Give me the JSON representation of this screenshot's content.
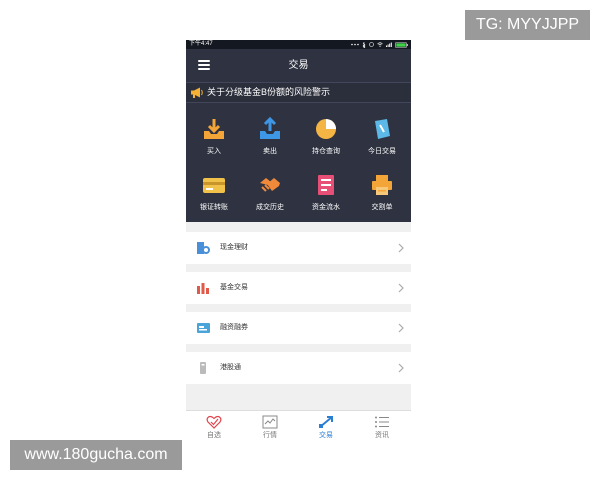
{
  "watermarks": {
    "top_right": "TG: MYYJJPP",
    "bottom_left": "www.180gucha.com"
  },
  "status_bar": {
    "time": "下午4:47",
    "icons": [
      "dots-icon",
      "bluetooth-icon",
      "alarm-icon",
      "wifi-icon",
      "signal-icon",
      "battery-icon"
    ]
  },
  "header": {
    "title": "交易",
    "menu_icon": "menu-icon"
  },
  "notice": {
    "text": "关于分级基金B份额的风险警示",
    "icon": "megaphone-icon"
  },
  "grid": [
    {
      "label": "买入",
      "icon": "buy-download-icon",
      "color": "#f3a537"
    },
    {
      "label": "卖出",
      "icon": "sell-upload-icon",
      "color": "#3d97e6"
    },
    {
      "label": "持仓查询",
      "icon": "pie-chart-icon",
      "color": "#f5b545"
    },
    {
      "label": "今日交易",
      "icon": "note-pencil-icon",
      "color": "#5bb8e8"
    },
    {
      "label": "银证转账",
      "icon": "card-icon",
      "color": "#f0c24a"
    },
    {
      "label": "成交历史",
      "icon": "handshake-icon",
      "color": "#f08a3a"
    },
    {
      "label": "资金流水",
      "icon": "ledger-icon",
      "color": "#e84f76"
    },
    {
      "label": "交割单",
      "icon": "printer-icon",
      "color": "#f3a537"
    }
  ],
  "list": [
    {
      "label": "现金理财",
      "icon": "cash-management-icon",
      "color": "#4a90d9"
    },
    {
      "label": "基金交易",
      "icon": "fund-chart-icon",
      "color": "#e05a4a"
    },
    {
      "label": "融资融券",
      "icon": "margin-trading-icon",
      "color": "#4aa3d9"
    },
    {
      "label": "港股通",
      "icon": "hk-connect-icon",
      "color": "#aaaaaa"
    }
  ],
  "tabbar": [
    {
      "label": "自选",
      "icon": "heart-check-icon",
      "active": false
    },
    {
      "label": "行情",
      "icon": "market-chart-icon",
      "active": false
    },
    {
      "label": "交易",
      "icon": "trade-arrows-icon",
      "active": true
    },
    {
      "label": "资讯",
      "icon": "news-list-icon",
      "active": false
    }
  ],
  "colors": {
    "header_bg": "#2f3341",
    "accent_blue": "#2a7fd4",
    "list_bg": "#ffffff",
    "page_bg": "#f0f0f0"
  }
}
